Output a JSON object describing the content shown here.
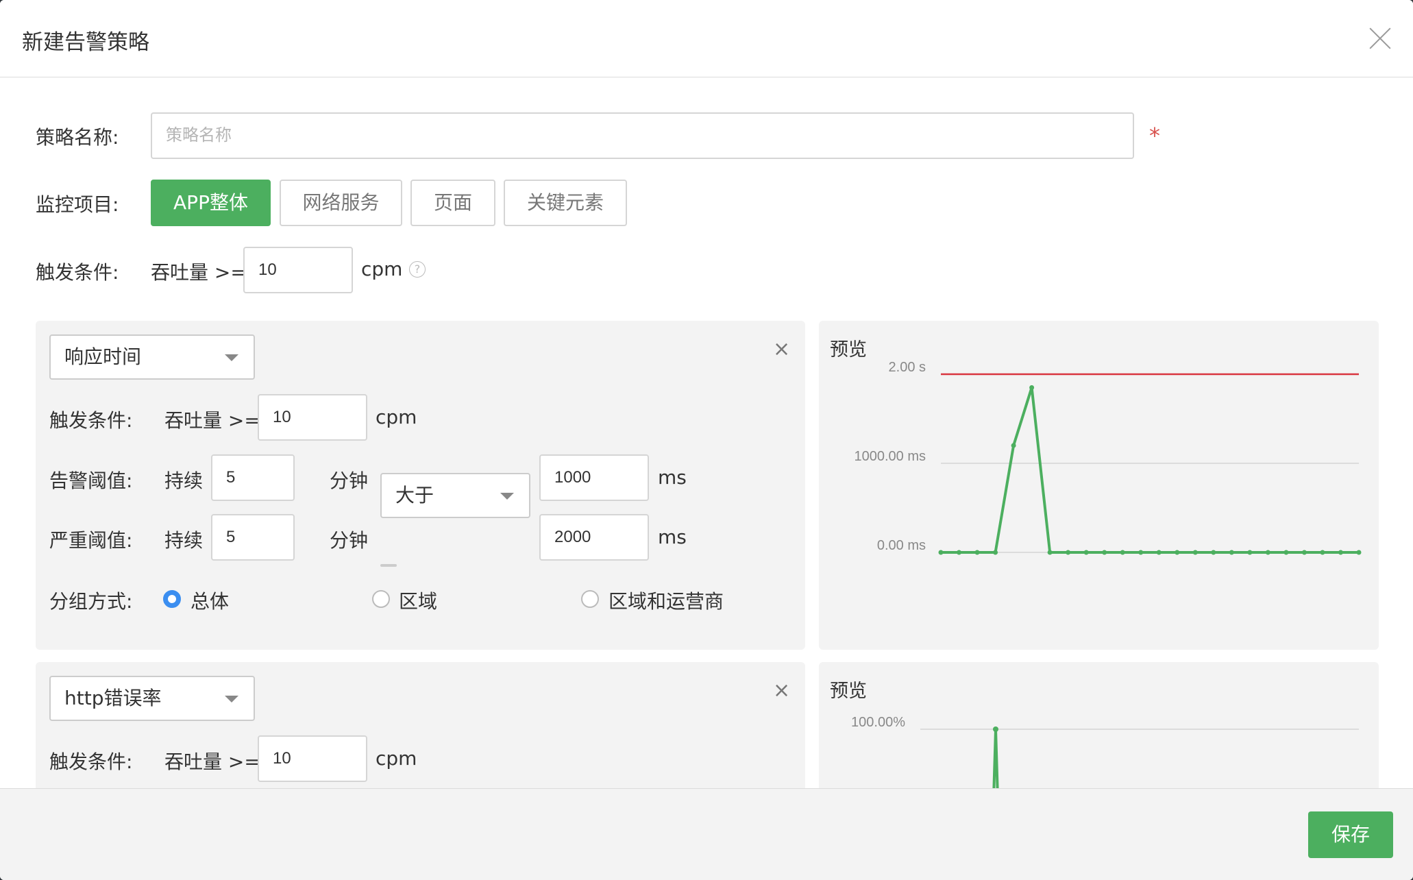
{
  "modal": {
    "title": "新建告警策略",
    "save_label": "保存"
  },
  "form": {
    "policy_name_label": "策略名称:",
    "policy_name_placeholder": "策略名称",
    "policy_name_value": "",
    "required_mark": "*",
    "monitor_label": "监控项目:",
    "monitor_tabs": [
      {
        "label": "APP整体",
        "active": true
      },
      {
        "label": "网络服务",
        "active": false
      },
      {
        "label": "页面",
        "active": false
      },
      {
        "label": "关键元素",
        "active": false
      }
    ],
    "trigger_label": "触发条件:",
    "throughput_label": "吞吐量 >=",
    "throughput_value": "10",
    "throughput_unit": "cpm",
    "help_icon": "question-circle-icon"
  },
  "rules": [
    {
      "metric": "响应时间",
      "trigger_label": "触发条件:",
      "throughput_label": "吞吐量 >=",
      "throughput_value": "10",
      "throughput_unit": "cpm",
      "warn_label": "告警阈值:",
      "critical_label": "严重阈值:",
      "duration_label": "持续",
      "minute_label": "分钟",
      "warn_duration": "5",
      "critical_duration": "5",
      "comparator": "大于",
      "warn_value": "1000",
      "critical_value": "2000",
      "value_unit": "ms",
      "group_label": "分组方式:",
      "group_options": [
        {
          "label": "总体",
          "checked": true
        },
        {
          "label": "区域",
          "checked": false
        },
        {
          "label": "区域和运营商",
          "checked": false
        }
      ],
      "preview_title": "预览"
    },
    {
      "metric": "http错误率",
      "trigger_label": "触发条件:",
      "throughput_label": "吞吐量 >=",
      "throughput_value": "10",
      "throughput_unit": "cpm",
      "preview_title": "预览"
    }
  ],
  "chart_data": [
    {
      "type": "line",
      "title": "预览",
      "y_tick_labels": [
        "2.00 s",
        "1000.00 ms",
        "0.00 ms"
      ],
      "ylim": [
        0,
        2000
      ],
      "threshold": {
        "value": 2000,
        "color": "#d9343f"
      },
      "series": [
        {
          "color": "#4caf5f",
          "values": [
            0,
            0,
            0,
            0,
            1200,
            1850,
            0,
            0,
            0,
            0,
            0,
            0,
            0,
            0,
            0,
            0,
            0,
            0,
            0,
            0,
            0,
            0,
            0,
            0
          ]
        }
      ]
    },
    {
      "type": "line",
      "title": "预览",
      "y_tick_labels": [
        "100.00%"
      ],
      "series": [
        {
          "color": "#4caf5f",
          "values": [
            100
          ]
        }
      ]
    }
  ]
}
